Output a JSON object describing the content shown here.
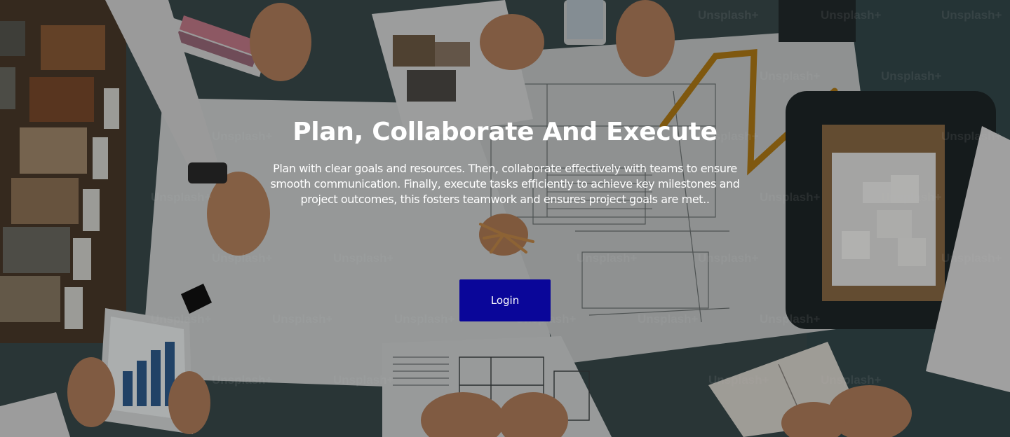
{
  "hero": {
    "title": "Plan, Collaborate And Execute",
    "description": "Plan with clear goals and resources. Then, collaborate effectively with teams to ensure smooth communication. Finally, execute tasks efficiently to achieve key milestones and project outcomes, this fosters teamwork and ensures project goals are met..",
    "login_label": "Login",
    "background_image": "overhead view of an architecture team meeting around blueprints, rulers, material samples and a tablet",
    "watermark_text": "Unsplash+"
  },
  "colors": {
    "login_button": "#0a0699",
    "text": "#ffffff",
    "table": "#2e3c3f"
  }
}
